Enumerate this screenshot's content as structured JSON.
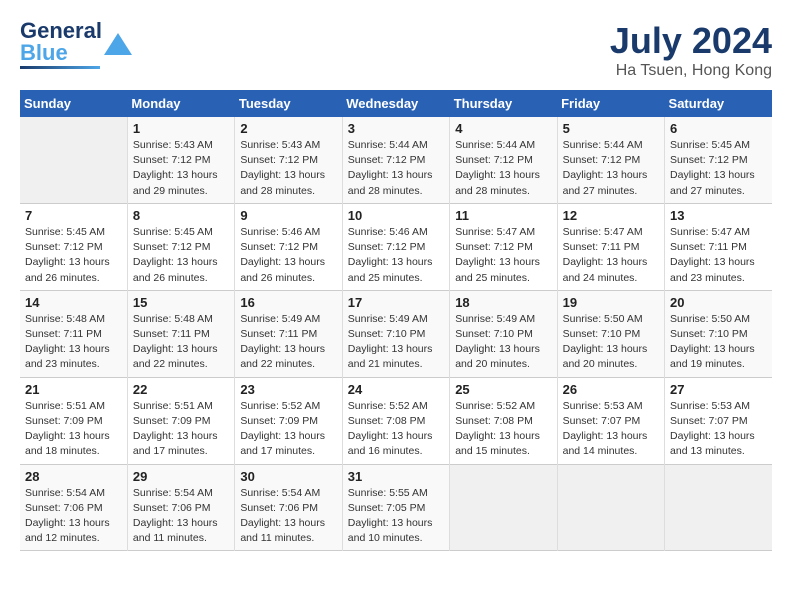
{
  "header": {
    "logo_line1": "General",
    "logo_line2": "Blue",
    "month_year": "July 2024",
    "location": "Ha Tsuen, Hong Kong"
  },
  "weekdays": [
    "Sunday",
    "Monday",
    "Tuesday",
    "Wednesday",
    "Thursday",
    "Friday",
    "Saturday"
  ],
  "weeks": [
    [
      {
        "day": "",
        "empty": true
      },
      {
        "day": "1",
        "sunrise": "5:43 AM",
        "sunset": "7:12 PM",
        "daylight": "13 hours and 29 minutes."
      },
      {
        "day": "2",
        "sunrise": "5:43 AM",
        "sunset": "7:12 PM",
        "daylight": "13 hours and 28 minutes."
      },
      {
        "day": "3",
        "sunrise": "5:44 AM",
        "sunset": "7:12 PM",
        "daylight": "13 hours and 28 minutes."
      },
      {
        "day": "4",
        "sunrise": "5:44 AM",
        "sunset": "7:12 PM",
        "daylight": "13 hours and 28 minutes."
      },
      {
        "day": "5",
        "sunrise": "5:44 AM",
        "sunset": "7:12 PM",
        "daylight": "13 hours and 27 minutes."
      },
      {
        "day": "6",
        "sunrise": "5:45 AM",
        "sunset": "7:12 PM",
        "daylight": "13 hours and 27 minutes."
      }
    ],
    [
      {
        "day": "7",
        "sunrise": "5:45 AM",
        "sunset": "7:12 PM",
        "daylight": "13 hours and 26 minutes."
      },
      {
        "day": "8",
        "sunrise": "5:45 AM",
        "sunset": "7:12 PM",
        "daylight": "13 hours and 26 minutes."
      },
      {
        "day": "9",
        "sunrise": "5:46 AM",
        "sunset": "7:12 PM",
        "daylight": "13 hours and 26 minutes."
      },
      {
        "day": "10",
        "sunrise": "5:46 AM",
        "sunset": "7:12 PM",
        "daylight": "13 hours and 25 minutes."
      },
      {
        "day": "11",
        "sunrise": "5:47 AM",
        "sunset": "7:12 PM",
        "daylight": "13 hours and 25 minutes."
      },
      {
        "day": "12",
        "sunrise": "5:47 AM",
        "sunset": "7:11 PM",
        "daylight": "13 hours and 24 minutes."
      },
      {
        "day": "13",
        "sunrise": "5:47 AM",
        "sunset": "7:11 PM",
        "daylight": "13 hours and 23 minutes."
      }
    ],
    [
      {
        "day": "14",
        "sunrise": "5:48 AM",
        "sunset": "7:11 PM",
        "daylight": "13 hours and 23 minutes."
      },
      {
        "day": "15",
        "sunrise": "5:48 AM",
        "sunset": "7:11 PM",
        "daylight": "13 hours and 22 minutes."
      },
      {
        "day": "16",
        "sunrise": "5:49 AM",
        "sunset": "7:11 PM",
        "daylight": "13 hours and 22 minutes."
      },
      {
        "day": "17",
        "sunrise": "5:49 AM",
        "sunset": "7:10 PM",
        "daylight": "13 hours and 21 minutes."
      },
      {
        "day": "18",
        "sunrise": "5:49 AM",
        "sunset": "7:10 PM",
        "daylight": "13 hours and 20 minutes."
      },
      {
        "day": "19",
        "sunrise": "5:50 AM",
        "sunset": "7:10 PM",
        "daylight": "13 hours and 20 minutes."
      },
      {
        "day": "20",
        "sunrise": "5:50 AM",
        "sunset": "7:10 PM",
        "daylight": "13 hours and 19 minutes."
      }
    ],
    [
      {
        "day": "21",
        "sunrise": "5:51 AM",
        "sunset": "7:09 PM",
        "daylight": "13 hours and 18 minutes."
      },
      {
        "day": "22",
        "sunrise": "5:51 AM",
        "sunset": "7:09 PM",
        "daylight": "13 hours and 17 minutes."
      },
      {
        "day": "23",
        "sunrise": "5:52 AM",
        "sunset": "7:09 PM",
        "daylight": "13 hours and 17 minutes."
      },
      {
        "day": "24",
        "sunrise": "5:52 AM",
        "sunset": "7:08 PM",
        "daylight": "13 hours and 16 minutes."
      },
      {
        "day": "25",
        "sunrise": "5:52 AM",
        "sunset": "7:08 PM",
        "daylight": "13 hours and 15 minutes."
      },
      {
        "day": "26",
        "sunrise": "5:53 AM",
        "sunset": "7:07 PM",
        "daylight": "13 hours and 14 minutes."
      },
      {
        "day": "27",
        "sunrise": "5:53 AM",
        "sunset": "7:07 PM",
        "daylight": "13 hours and 13 minutes."
      }
    ],
    [
      {
        "day": "28",
        "sunrise": "5:54 AM",
        "sunset": "7:06 PM",
        "daylight": "13 hours and 12 minutes."
      },
      {
        "day": "29",
        "sunrise": "5:54 AM",
        "sunset": "7:06 PM",
        "daylight": "13 hours and 11 minutes."
      },
      {
        "day": "30",
        "sunrise": "5:54 AM",
        "sunset": "7:06 PM",
        "daylight": "13 hours and 11 minutes."
      },
      {
        "day": "31",
        "sunrise": "5:55 AM",
        "sunset": "7:05 PM",
        "daylight": "13 hours and 10 minutes."
      },
      {
        "day": "",
        "empty": true
      },
      {
        "day": "",
        "empty": true
      },
      {
        "day": "",
        "empty": true
      }
    ]
  ],
  "labels": {
    "sunrise": "Sunrise:",
    "sunset": "Sunset:",
    "daylight": "Daylight:"
  }
}
